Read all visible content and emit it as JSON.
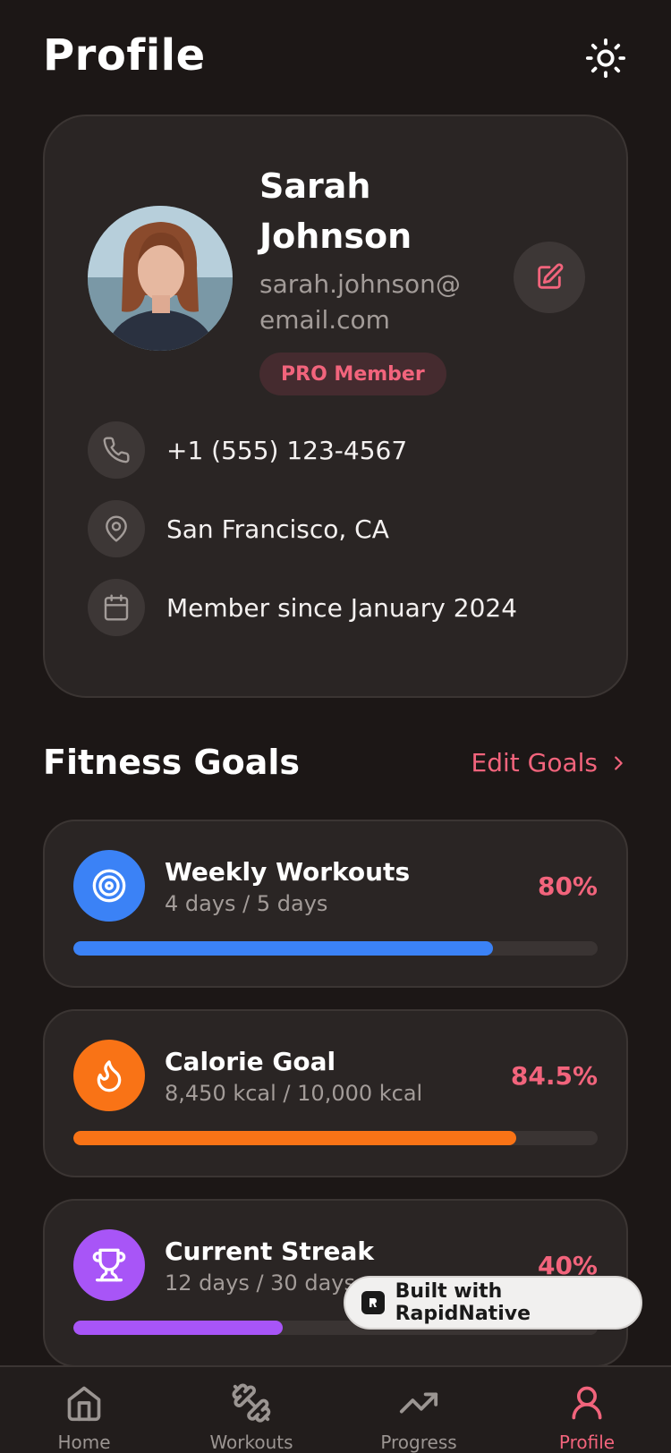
{
  "header": {
    "title": "Profile",
    "theme_icon": "sun-icon"
  },
  "profile": {
    "name": "Sarah Johnson",
    "email": "sarah.johnson@email.com",
    "badge": "PRO Member",
    "edit_icon": "edit-icon",
    "info": [
      {
        "icon": "phone-icon",
        "text": "+1 (555) 123-4567"
      },
      {
        "icon": "location-pin-icon",
        "text": "San Francisco, CA"
      },
      {
        "icon": "calendar-icon",
        "text": "Member since January 2024"
      }
    ]
  },
  "goals_section": {
    "title": "Fitness Goals",
    "edit_label": "Edit Goals",
    "goals": [
      {
        "icon": "target-icon",
        "title": "Weekly Workouts",
        "subtitle": "4 days / 5 days",
        "percent_label": "80%",
        "progress": 0.8,
        "color": "#3b82f6"
      },
      {
        "icon": "flame-icon",
        "title": "Calorie Goal",
        "subtitle": "8,450 kcal / 10,000 kcal",
        "percent_label": "84.5%",
        "progress": 0.845,
        "color": "#f97316"
      },
      {
        "icon": "trophy-icon",
        "title": "Current Streak",
        "subtitle": "12 days / 30 days",
        "percent_label": "40%",
        "progress": 0.4,
        "color": "#a855f7"
      }
    ]
  },
  "promo": {
    "label": "Built with RapidNative"
  },
  "nav": {
    "items": [
      {
        "icon": "home-icon",
        "label": "Home",
        "active": false
      },
      {
        "icon": "dumbbell-icon",
        "label": "Workouts",
        "active": false
      },
      {
        "icon": "trending-up-icon",
        "label": "Progress",
        "active": false
      },
      {
        "icon": "user-icon",
        "label": "Profile",
        "active": true
      }
    ]
  },
  "colors": {
    "accent": "#f2647c",
    "background": "#1c1716",
    "card": "#2a2524"
  }
}
